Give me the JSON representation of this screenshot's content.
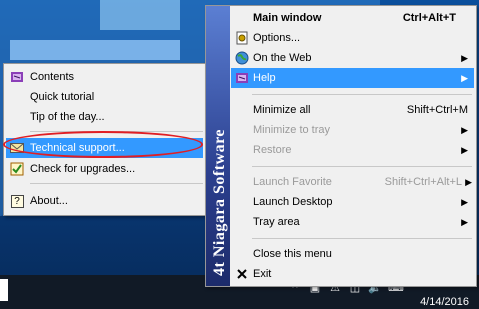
{
  "main_menu": {
    "items": [
      {
        "label": "Main window",
        "shortcut": "Ctrl+Alt+T",
        "bold": true
      },
      {
        "label": "Options..."
      },
      {
        "label": "On the Web",
        "arrow": true
      },
      {
        "label": "Help",
        "arrow": true,
        "highlighted": true
      },
      {
        "label": "Minimize all",
        "shortcut": "Shift+Ctrl+M"
      },
      {
        "label": "Minimize to tray",
        "arrow": true,
        "disabled": true
      },
      {
        "label": "Restore",
        "arrow": true,
        "disabled": true
      },
      {
        "label": "Launch Favorite",
        "shortcut": "Shift+Ctrl+Alt+L",
        "arrow": true,
        "disabled": true
      },
      {
        "label": "Launch Desktop",
        "arrow": true
      },
      {
        "label": "Tray area",
        "arrow": true
      },
      {
        "label": "Close this menu"
      },
      {
        "label": "Exit"
      }
    ],
    "brand": "4t Niagara Software"
  },
  "help_submenu": {
    "items": [
      {
        "label": "Contents"
      },
      {
        "label": "Quick tutorial"
      },
      {
        "label": "Tip of the day..."
      },
      {
        "label": "Technical support...",
        "highlighted": true
      },
      {
        "label": "Check for upgrades..."
      },
      {
        "label": "About..."
      }
    ]
  },
  "taskbar": {
    "date": "4/14/2016"
  },
  "icons": {
    "options": "gear-document-icon",
    "web": "globe-icon",
    "help": "help-book-icon",
    "contents": "help-book-icon",
    "support": "envelope-icon",
    "upgrades": "checklist-icon",
    "about": "question-box-icon",
    "exit": "close-x-icon"
  },
  "colors": {
    "highlight": "#3399ff",
    "annotation": "#e01e24",
    "brand_strip": "#2b3f8e"
  }
}
